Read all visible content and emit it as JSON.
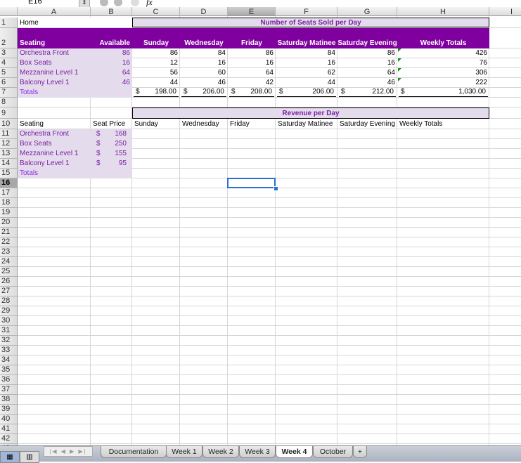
{
  "formula_bar": {
    "name_box": "E16",
    "fx_label": "fx"
  },
  "columns": [
    "A",
    "B",
    "C",
    "D",
    "E",
    "F",
    "G",
    "H",
    "I"
  ],
  "selected_cell": "E16",
  "colors": {
    "header_purple": "#7f009f",
    "lavender": "#e4dcec",
    "text_purple": "#7a1fa2",
    "selection": "#2a6fd6"
  },
  "cells": {
    "A1": "Home",
    "E1": "Number of Seats Sold per Day",
    "A2": "Seating",
    "B2": "Available",
    "C2": "Sunday",
    "D2": "Wednesday",
    "E2": "Friday",
    "F2": "Saturday Matinee",
    "G2": "Saturday Evening",
    "H2": "Weekly Totals",
    "A3": "Orchestra  Front",
    "B3": "86",
    "C3": "86",
    "D3": "84",
    "E3": "86",
    "F3": "84",
    "G3": "86",
    "H3": "426",
    "A4": "Box Seats",
    "B4": "16",
    "C4": "12",
    "D4": "16",
    "E4": "16",
    "F4": "16",
    "G4": "16",
    "H4": "76",
    "A5": "Mezzanine Level 1",
    "B5": "64",
    "C5": "56",
    "D5": "60",
    "E5": "64",
    "F5": "62",
    "G5": "64",
    "H5": "306",
    "A6": "Balcony Level 1",
    "B6": "46",
    "C6": "44",
    "D6": "46",
    "E6": "42",
    "F6": "44",
    "G6": "46",
    "H6": "222",
    "A7": "Totals",
    "C7": "198.00",
    "D7": "206.00",
    "E7": "208.00",
    "F7": "206.00",
    "G7": "212.00",
    "H7": "1,030.00",
    "E9": "Revenue per Day",
    "A10": "Seating",
    "B10": "Seat Price",
    "C10": "Sunday",
    "D10": "Wednesday",
    "E10": "Friday",
    "F10": "Saturday Matinee",
    "G10": "Saturday Evening",
    "H10": "Weekly Totals",
    "A11": "Orchestra  Front",
    "B11": "168",
    "A12": "Box Seats",
    "B12": "250",
    "A13": "Mezzanine Level 1",
    "B13": "155",
    "A14": "Balcony Level 1",
    "B14": "95",
    "A15": "Totals"
  },
  "currency_symbol": "$",
  "sheet_tabs": [
    "Documentation",
    "Week 1",
    "Week 2",
    "Week 3",
    "Week 4",
    "October",
    "+"
  ],
  "active_tab": "Week 4"
}
